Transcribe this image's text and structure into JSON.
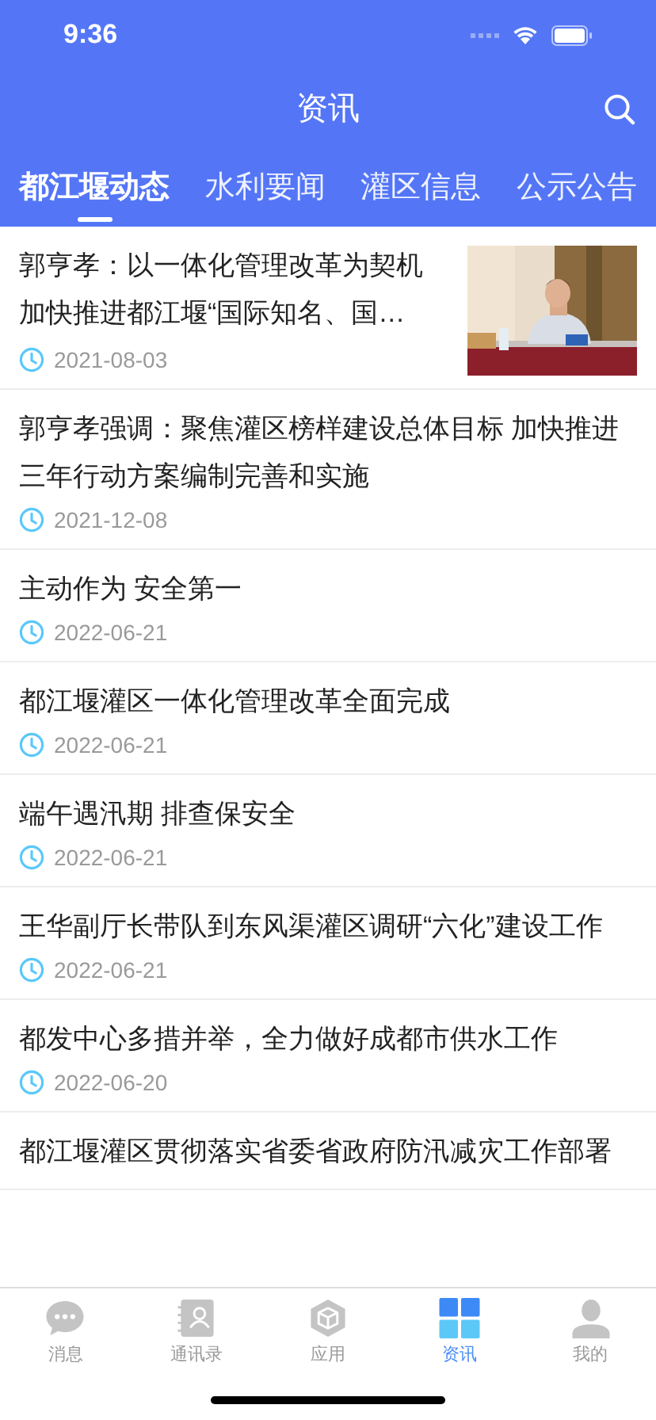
{
  "status_bar": {
    "time": "9:36"
  },
  "header": {
    "title": "资讯"
  },
  "tabs": [
    {
      "label": "都江堰动态",
      "selected": true
    },
    {
      "label": "水利要闻",
      "selected": false
    },
    {
      "label": "灌区信息",
      "selected": false
    },
    {
      "label": "公示公告",
      "selected": false
    }
  ],
  "news": [
    {
      "title": "郭亨孝：以一体化管理改革为契机加快推进都江堰“国际知名、国…",
      "date": "2021-08-03"
    },
    {
      "title": "郭亨孝强调：聚焦灌区榜样建设总体目标 加快推进三年行动方案编制完善和实施",
      "date": "2021-12-08"
    },
    {
      "title": "主动作为 安全第一",
      "date": "2022-06-21"
    },
    {
      "title": "都江堰灌区一体化管理改革全面完成",
      "date": "2022-06-21"
    },
    {
      "title": "端午遇汛期 排查保安全",
      "date": "2022-06-21"
    },
    {
      "title": "王华副厅长带队到东风渠灌区调研“六化”建设工作",
      "date": "2022-06-21"
    },
    {
      "title": "都发中心多措并举，全力做好成都市供水工作",
      "date": "2022-06-20"
    },
    {
      "title": "都江堰灌区贯彻落实省委省政府防汛减灾工作部署"
    }
  ],
  "bottom_nav": [
    {
      "label": "消息",
      "kind": "chat",
      "selected": false
    },
    {
      "label": "通讯录",
      "kind": "contacts",
      "selected": false
    },
    {
      "label": "应用",
      "kind": "apps",
      "selected": false
    },
    {
      "label": "资讯",
      "kind": "news",
      "selected": true
    },
    {
      "label": "我的",
      "kind": "profile",
      "selected": false
    }
  ]
}
